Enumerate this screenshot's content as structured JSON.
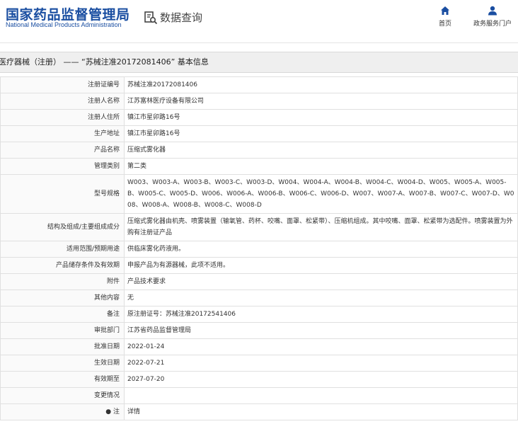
{
  "header": {
    "logo_cn": "国家药品监督管理局",
    "logo_en": "National Medical Products Administration",
    "query_label": "数据查询",
    "home_label": "首页",
    "portal_label": "政务服务门户",
    "icons": {
      "query": "search-document-icon",
      "home": "home-icon",
      "portal": "user-icon"
    },
    "accent_color": "#1a4ea1"
  },
  "title_bar": {
    "text": "医疗器械（注册） —— “苏械注准20172081406” 基本信息"
  },
  "rows": [
    {
      "label": "注册证编号",
      "value": "苏械注准20172081406"
    },
    {
      "label": "注册人名称",
      "value": "江苏富林医疗设备有限公司"
    },
    {
      "label": "注册人住所",
      "value": "镇江市星卯路16号"
    },
    {
      "label": "生产地址",
      "value": "镇江市星卯路16号"
    },
    {
      "label": "产品名称",
      "value": "压缩式雾化器"
    },
    {
      "label": "管理类别",
      "value": "第二类"
    },
    {
      "label": "型号规格",
      "value": "W003、W003-A、W003-B、W003-C、W003-D、W004、W004-A、W004-B、W004-C、W004-D、W005、W005-A、W005-B、W005-C、W005-D、W006、W006-A、W006-B、W006-C、W006-D、W007、W007-A、W007-B、W007-C、W007-D、W008、W008-A、W008-B、W008-C、W008-D"
    },
    {
      "label": "结构及组成/主要组成成分",
      "value": "压缩式雾化器由机壳、喷雾装置（输氧管、药杯、咬嘴、面罩、松紧带）、压缩机组成。其中咬嘴、面罩、松紧带为选配件。喷雾装置为外购有注册证产品"
    },
    {
      "label": "适用范围/预期用途",
      "value": "供临床雾化药液用。"
    },
    {
      "label": "产品储存条件及有效期",
      "value": "申报产品为有源器械，此项不适用。"
    },
    {
      "label": "附件",
      "value": "产品技术要求"
    },
    {
      "label": "其他内容",
      "value": "无"
    },
    {
      "label": "备注",
      "value": "原注册证号：苏械注准20172541406"
    },
    {
      "label": "审批部门",
      "value": "江苏省药品监督管理局"
    },
    {
      "label": "批准日期",
      "value": "2022-01-24"
    },
    {
      "label": "生效日期",
      "value": "2022-07-21"
    },
    {
      "label": "有效期至",
      "value": "2027-07-20"
    },
    {
      "label": "变更情况",
      "value": ""
    },
    {
      "label": "● 注",
      "value": "详情"
    }
  ]
}
